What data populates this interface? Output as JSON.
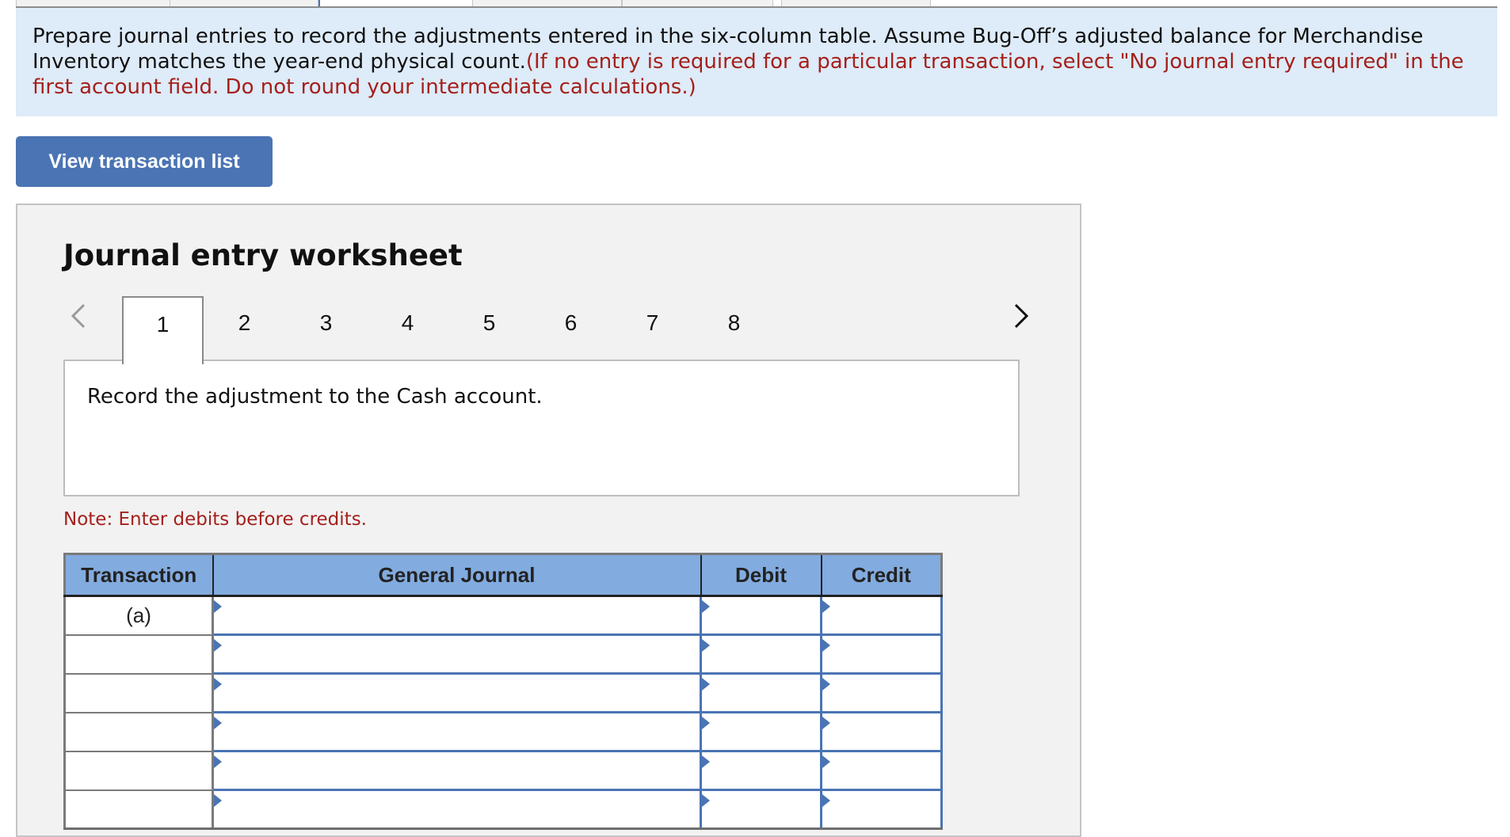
{
  "top_tabs": {
    "count": 6,
    "active_index": 2
  },
  "instructions": {
    "text_black": "Prepare journal entries to record the adjustments entered in the six-column table. Assume Bug-Off’s adjusted balance for Merchandise Inventory matches the year-end physical count.",
    "text_red": "(If no entry is required for a particular transaction, select \"No journal entry required\" in the first account field. Do not round your intermediate calculations.)"
  },
  "view_transaction_button": "View transaction list",
  "worksheet": {
    "title": "Journal entry worksheet",
    "prev_icon": "chevron-left-icon",
    "next_icon": "chevron-right-icon",
    "steps": [
      "1",
      "2",
      "3",
      "4",
      "5",
      "6",
      "7",
      "8"
    ],
    "active_step": "1",
    "description": "Record the adjustment to the Cash account.",
    "note": "Note: Enter debits before credits."
  },
  "journal_table": {
    "headers": [
      "Transaction",
      "General Journal",
      "Debit",
      "Credit"
    ],
    "rows": [
      {
        "transaction": "(a)",
        "account": "",
        "debit": "",
        "credit": ""
      },
      {
        "transaction": "",
        "account": "",
        "debit": "",
        "credit": ""
      },
      {
        "transaction": "",
        "account": "",
        "debit": "",
        "credit": ""
      },
      {
        "transaction": "",
        "account": "",
        "debit": "",
        "credit": ""
      },
      {
        "transaction": "",
        "account": "",
        "debit": "",
        "credit": ""
      },
      {
        "transaction": "",
        "account": "",
        "debit": "",
        "credit": ""
      }
    ]
  },
  "colors": {
    "accent_blue": "#4a74b4",
    "header_blue": "#82abdf",
    "instruction_bg": "#deebf8",
    "note_red": "#a4201c",
    "panel_bg": "#f2f2f2"
  }
}
